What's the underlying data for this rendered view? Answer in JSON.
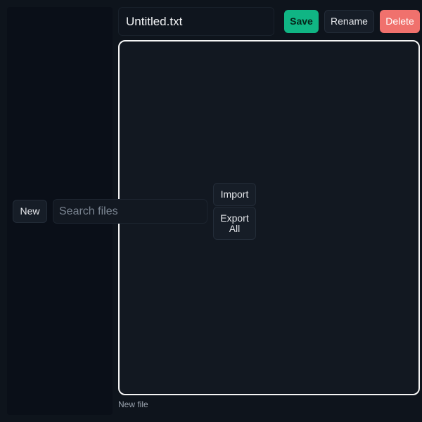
{
  "editor_header": {
    "filename": "Untitled.txt",
    "save_label": "Save",
    "rename_label": "Rename",
    "delete_label": "Delete"
  },
  "sidebar": {
    "new_label": "New",
    "search_placeholder": "Search files"
  },
  "editor_body": {
    "content": ""
  },
  "toolbar": {
    "import_label": "Import",
    "export_label": "Export All"
  },
  "status": {
    "text": "New file"
  },
  "colors": {
    "background": "#0e141c",
    "save_accent": "#10b584",
    "delete_accent": "#f0716d",
    "editor_border": "#f5f5f5"
  }
}
